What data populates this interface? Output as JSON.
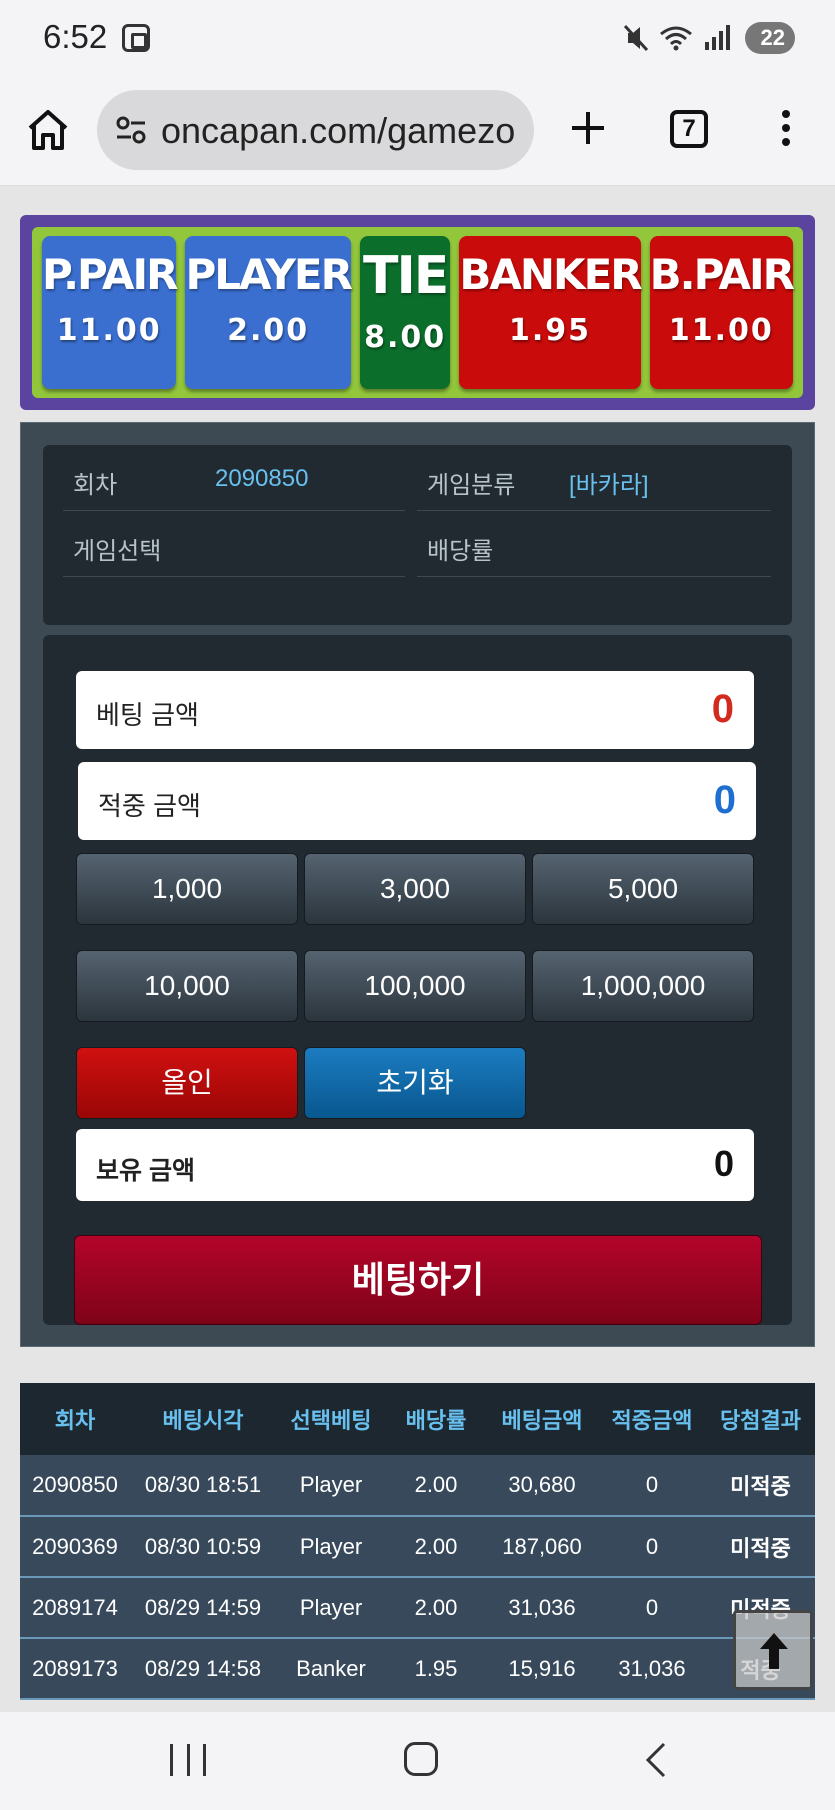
{
  "status": {
    "time": "6:52",
    "battery": "22"
  },
  "browser": {
    "url": "oncapan.com/gamezo",
    "tab_count": "7"
  },
  "odds": [
    {
      "name": "P.PAIR",
      "value": "11.00",
      "color": "#3a6fd0"
    },
    {
      "name": "PLAYER",
      "value": "2.00",
      "color": "#3a6fd0"
    },
    {
      "name": "TIE",
      "value": "8.00",
      "color": "#0b6e2b"
    },
    {
      "name": "BANKER",
      "value": "1.95",
      "color": "#c90b0b"
    },
    {
      "name": "B.PAIR",
      "value": "11.00",
      "color": "#c90b0b"
    }
  ],
  "info": {
    "round_label": "회차",
    "round_value": "2090850",
    "category_label": "게임분류",
    "category_value": "[바카라]",
    "selection_label": "게임선택",
    "selection_value": "",
    "odds_label": "배당률",
    "odds_value": ""
  },
  "bet": {
    "bet_amount_label": "베팅 금액",
    "bet_amount_value": "0",
    "win_amount_label": "적중 금액",
    "win_amount_value": "0",
    "chips": [
      "1,000",
      "3,000",
      "5,000",
      "10,000",
      "100,000",
      "1,000,000"
    ],
    "allin_label": "올인",
    "reset_label": "초기화",
    "hold_label": "보유 금액",
    "hold_value": "0",
    "submit_label": "베팅하기"
  },
  "history": {
    "headers": [
      "회차",
      "베팅시각",
      "선택베팅",
      "배당률",
      "베팅금액",
      "적중금액",
      "당첨결과"
    ],
    "rows": [
      [
        "2090850",
        "08/30 18:51",
        "Player",
        "2.00",
        "30,680",
        "0",
        "미적중"
      ],
      [
        "2090369",
        "08/30 10:59",
        "Player",
        "2.00",
        "187,060",
        "0",
        "미적중"
      ],
      [
        "2089174",
        "08/29 14:59",
        "Player",
        "2.00",
        "31,036",
        "0",
        "미적중"
      ],
      [
        "2089173",
        "08/29 14:58",
        "Banker",
        "1.95",
        "15,916",
        "31,036",
        "적중"
      ]
    ]
  }
}
